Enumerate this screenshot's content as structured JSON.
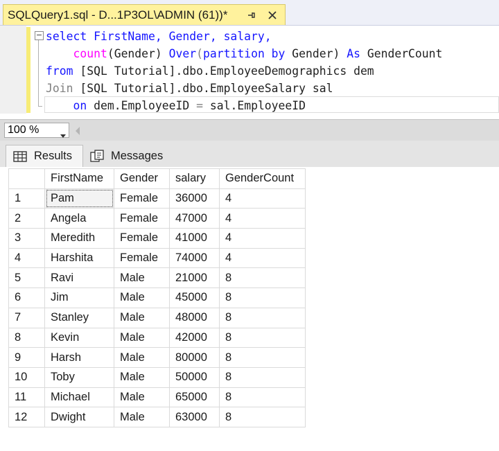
{
  "tab": {
    "title": "SQLQuery1.sql - D...1P3OL\\ADMIN (61))*"
  },
  "editor": {
    "collapse_symbol": "−",
    "lines": [
      [
        "select FirstName, Gender, salary,"
      ],
      [
        "count",
        "(Gender) ",
        "Over",
        "(",
        "partition by",
        " Gender) ",
        "As",
        " GenderCount"
      ],
      [
        "from",
        " [SQL Tutorial].dbo.EmployeeDemographics dem"
      ],
      [
        "Join",
        " [SQL Tutorial].dbo.EmployeeSalary sal"
      ],
      [
        "on",
        " dem.EmployeeID ",
        "=",
        " sal.EmployeeID"
      ]
    ]
  },
  "zoom": {
    "value": "100 %"
  },
  "results_tabs": {
    "results": "Results",
    "messages": "Messages"
  },
  "grid": {
    "columns": [
      "",
      "FirstName",
      "Gender",
      "salary",
      "GenderCount"
    ],
    "rows": [
      [
        "1",
        "Pam",
        "Female",
        "36000",
        "4"
      ],
      [
        "2",
        "Angela",
        "Female",
        "47000",
        "4"
      ],
      [
        "3",
        "Meredith",
        "Female",
        "41000",
        "4"
      ],
      [
        "4",
        "Harshita",
        "Female",
        "74000",
        "4"
      ],
      [
        "5",
        "Ravi",
        "Male",
        "21000",
        "8"
      ],
      [
        "6",
        "Jim",
        "Male",
        "45000",
        "8"
      ],
      [
        "7",
        "Stanley",
        "Male",
        "48000",
        "8"
      ],
      [
        "8",
        "Kevin",
        "Male",
        "42000",
        "8"
      ],
      [
        "9",
        "Harsh",
        "Male",
        "80000",
        "8"
      ],
      [
        "10",
        "Toby",
        "Male",
        "50000",
        "8"
      ],
      [
        "11",
        "Michael",
        "Male",
        "65000",
        "8"
      ],
      [
        "12",
        "Dwight",
        "Male",
        "63000",
        "8"
      ]
    ]
  },
  "colors": {
    "tab_active": "#fff29d",
    "keyword": "#1515ff",
    "function": "#ff00ff",
    "comment_gray": "#808080"
  },
  "icons": {
    "pin": "pin-icon",
    "close": "close-icon",
    "results": "grid-icon",
    "messages": "messages-icon"
  }
}
